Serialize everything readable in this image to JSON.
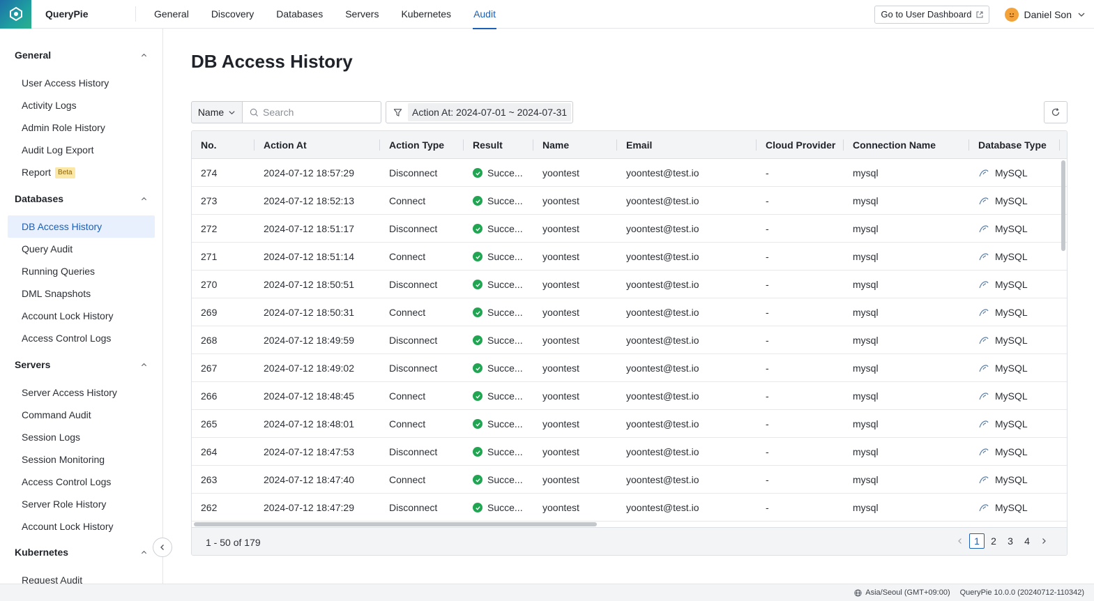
{
  "app": {
    "name": "QueryPie"
  },
  "nav": {
    "items": [
      {
        "label": "General",
        "active": false
      },
      {
        "label": "Discovery",
        "active": false
      },
      {
        "label": "Databases",
        "active": false
      },
      {
        "label": "Servers",
        "active": false
      },
      {
        "label": "Kubernetes",
        "active": false
      },
      {
        "label": "Audit",
        "active": true
      }
    ],
    "dashboard_button": "Go to User Dashboard",
    "user_name": "Daniel Son",
    "accent": "#1c5fb8"
  },
  "sidebar": {
    "sections": [
      {
        "title": "General",
        "items": [
          {
            "label": "User Access History"
          },
          {
            "label": "Activity Logs"
          },
          {
            "label": "Admin Role History"
          },
          {
            "label": "Audit Log Export"
          },
          {
            "label": "Report",
            "badge": "Beta"
          }
        ]
      },
      {
        "title": "Databases",
        "items": [
          {
            "label": "DB Access History",
            "active": true
          },
          {
            "label": "Query Audit"
          },
          {
            "label": "Running Queries"
          },
          {
            "label": "DML Snapshots"
          },
          {
            "label": "Account Lock History"
          },
          {
            "label": "Access Control Logs"
          }
        ]
      },
      {
        "title": "Servers",
        "items": [
          {
            "label": "Server Access History"
          },
          {
            "label": "Command Audit"
          },
          {
            "label": "Session Logs"
          },
          {
            "label": "Session Monitoring"
          },
          {
            "label": "Access Control Logs"
          },
          {
            "label": "Server Role History"
          },
          {
            "label": "Account Lock History"
          }
        ]
      },
      {
        "title": "Kubernetes",
        "items": [
          {
            "label": "Request Audit"
          }
        ]
      }
    ]
  },
  "page": {
    "title": "DB Access History",
    "filter": {
      "field": "Name",
      "search_placeholder": "Search",
      "chip": "Action At: 2024-07-01 ~ 2024-07-31"
    }
  },
  "table": {
    "columns": [
      "No.",
      "Action At",
      "Action Type",
      "Result",
      "Name",
      "Email",
      "Cloud Provider",
      "Connection Name",
      "Database Type"
    ],
    "rows": [
      {
        "no": "274",
        "action_at": "2024-07-12 18:57:29",
        "action_type": "Disconnect",
        "result": "Succe...",
        "name": "yoontest",
        "email": "yoontest@test.io",
        "cloud": "-",
        "connection": "mysql",
        "db_type": "MySQL"
      },
      {
        "no": "273",
        "action_at": "2024-07-12 18:52:13",
        "action_type": "Connect",
        "result": "Succe...",
        "name": "yoontest",
        "email": "yoontest@test.io",
        "cloud": "-",
        "connection": "mysql",
        "db_type": "MySQL"
      },
      {
        "no": "272",
        "action_at": "2024-07-12 18:51:17",
        "action_type": "Disconnect",
        "result": "Succe...",
        "name": "yoontest",
        "email": "yoontest@test.io",
        "cloud": "-",
        "connection": "mysql",
        "db_type": "MySQL"
      },
      {
        "no": "271",
        "action_at": "2024-07-12 18:51:14",
        "action_type": "Connect",
        "result": "Succe...",
        "name": "yoontest",
        "email": "yoontest@test.io",
        "cloud": "-",
        "connection": "mysql",
        "db_type": "MySQL"
      },
      {
        "no": "270",
        "action_at": "2024-07-12 18:50:51",
        "action_type": "Disconnect",
        "result": "Succe...",
        "name": "yoontest",
        "email": "yoontest@test.io",
        "cloud": "-",
        "connection": "mysql",
        "db_type": "MySQL"
      },
      {
        "no": "269",
        "action_at": "2024-07-12 18:50:31",
        "action_type": "Connect",
        "result": "Succe...",
        "name": "yoontest",
        "email": "yoontest@test.io",
        "cloud": "-",
        "connection": "mysql",
        "db_type": "MySQL"
      },
      {
        "no": "268",
        "action_at": "2024-07-12 18:49:59",
        "action_type": "Disconnect",
        "result": "Succe...",
        "name": "yoontest",
        "email": "yoontest@test.io",
        "cloud": "-",
        "connection": "mysql",
        "db_type": "MySQL"
      },
      {
        "no": "267",
        "action_at": "2024-07-12 18:49:02",
        "action_type": "Disconnect",
        "result": "Succe...",
        "name": "yoontest",
        "email": "yoontest@test.io",
        "cloud": "-",
        "connection": "mysql",
        "db_type": "MySQL"
      },
      {
        "no": "266",
        "action_at": "2024-07-12 18:48:45",
        "action_type": "Connect",
        "result": "Succe...",
        "name": "yoontest",
        "email": "yoontest@test.io",
        "cloud": "-",
        "connection": "mysql",
        "db_type": "MySQL"
      },
      {
        "no": "265",
        "action_at": "2024-07-12 18:48:01",
        "action_type": "Connect",
        "result": "Succe...",
        "name": "yoontest",
        "email": "yoontest@test.io",
        "cloud": "-",
        "connection": "mysql",
        "db_type": "MySQL"
      },
      {
        "no": "264",
        "action_at": "2024-07-12 18:47:53",
        "action_type": "Disconnect",
        "result": "Succe...",
        "name": "yoontest",
        "email": "yoontest@test.io",
        "cloud": "-",
        "connection": "mysql",
        "db_type": "MySQL"
      },
      {
        "no": "263",
        "action_at": "2024-07-12 18:47:40",
        "action_type": "Connect",
        "result": "Succe...",
        "name": "yoontest",
        "email": "yoontest@test.io",
        "cloud": "-",
        "connection": "mysql",
        "db_type": "MySQL"
      },
      {
        "no": "262",
        "action_at": "2024-07-12 18:47:29",
        "action_type": "Disconnect",
        "result": "Succe...",
        "name": "yoontest",
        "email": "yoontest@test.io",
        "cloud": "-",
        "connection": "mysql",
        "db_type": "MySQL"
      }
    ],
    "range_text": "1 - 50 of 179",
    "pages": [
      "1",
      "2",
      "3",
      "4"
    ],
    "current_page": "1",
    "success_color": "#22a553"
  },
  "statusbar": {
    "timezone": "Asia/Seoul (GMT+09:00)",
    "version": "QueryPie 10.0.0 (20240712-110342)"
  }
}
